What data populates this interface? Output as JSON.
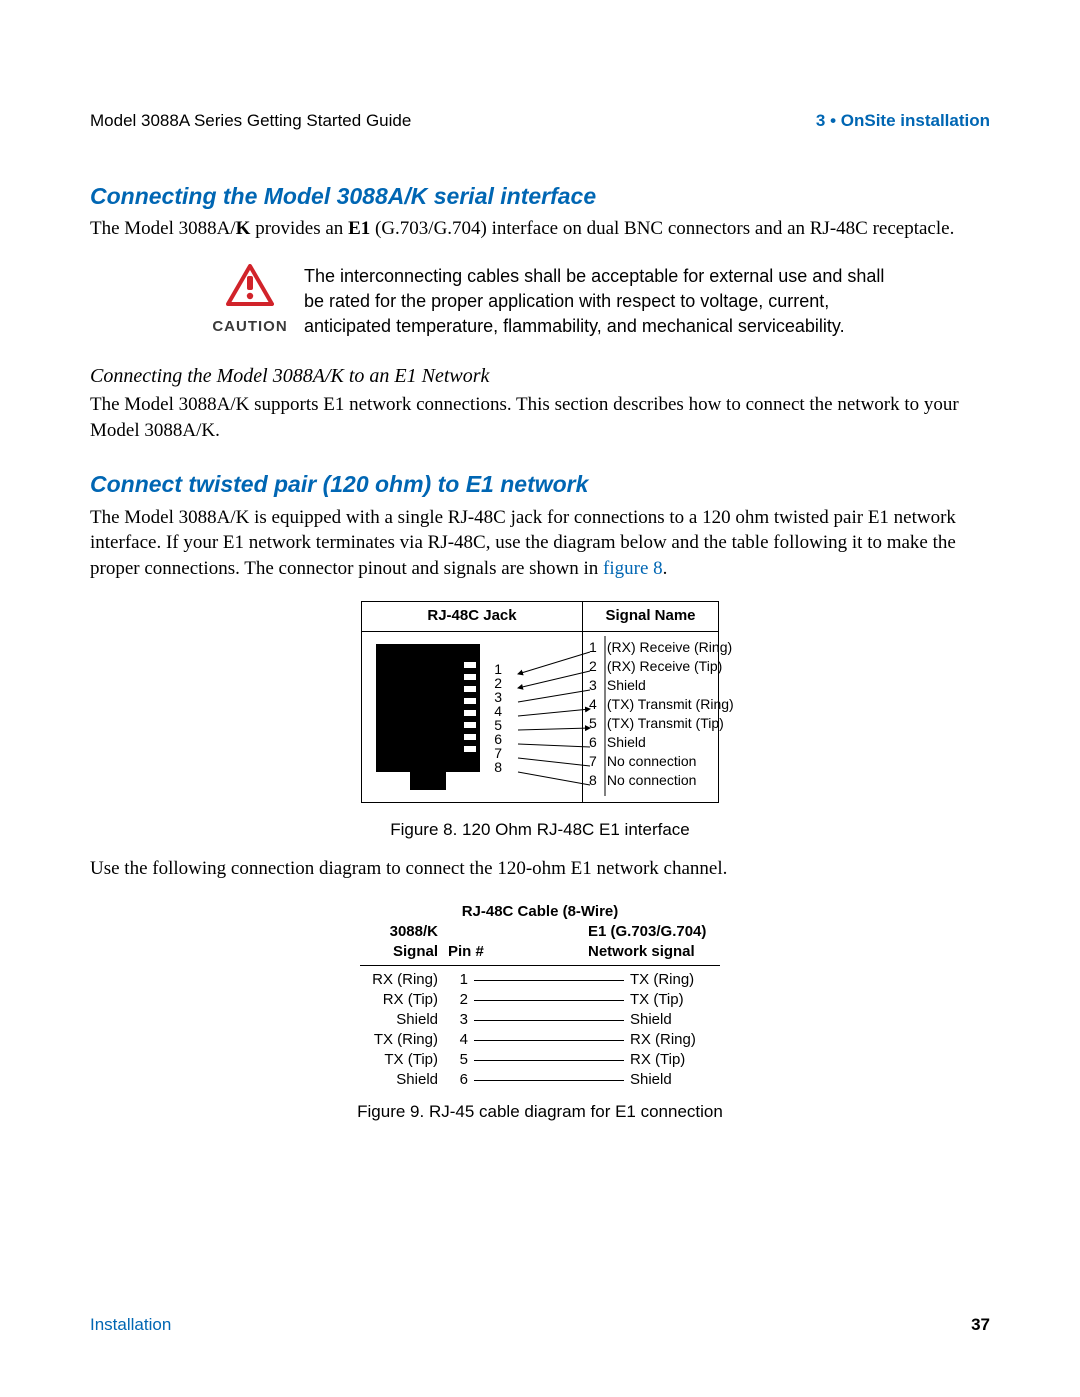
{
  "header": {
    "left": "Model 3088A Series Getting Started Guide",
    "right": "3 • OnSite installation"
  },
  "section1": {
    "heading": "Connecting the Model 3088A/K serial interface",
    "p1a": "The Model 3088A/",
    "p1b": "K",
    "p1c": " provides an ",
    "p1d": "E1",
    "p1e": " (G.703/G.704) interface on dual BNC connectors and an RJ-48C receptacle."
  },
  "caution": {
    "label": "CAUTION",
    "text": "The interconnecting cables shall be acceptable for external use and shall be rated for the proper application with respect to voltage, current, anticipated temperature, flammability, and mechanical serviceability."
  },
  "section2": {
    "subheading": "Connecting the Model 3088A/K to an E1 Network",
    "p": "The Model 3088A/K supports E1 network connections. This section describes how to connect the network to your Model 3088A/K."
  },
  "section3": {
    "heading": "Connect twisted pair (120 ohm) to E1 network",
    "p_pre": "The Model 3088A/K is equipped with a single RJ-48C jack for connections to a 120 ohm twisted pair E1 network interface. If your E1 network terminates via RJ-48C, use the diagram below and the table following it to make the proper connections. The connector pinout and signals are shown in ",
    "p_link": "figure 8",
    "p_post": "."
  },
  "fig8": {
    "col1": "RJ-48C Jack",
    "col2": "Signal Name",
    "jack_pins": [
      "1",
      "2",
      "3",
      "4",
      "5",
      "6",
      "7",
      "8"
    ],
    "signals": [
      {
        "pin": "1",
        "name": "(RX) Receive (Ring)"
      },
      {
        "pin": "2",
        "name": "(RX) Receive (Tip)"
      },
      {
        "pin": "3",
        "name": "Shield"
      },
      {
        "pin": "4",
        "name": "(TX) Transmit (Ring)"
      },
      {
        "pin": "5",
        "name": "(TX) Transmit (Tip)"
      },
      {
        "pin": "6",
        "name": "Shield"
      },
      {
        "pin": "7",
        "name": "No connection"
      },
      {
        "pin": "8",
        "name": "No connection"
      }
    ],
    "caption": "Figure 8. 120 Ohm RJ-48C E1 interface"
  },
  "after_fig8": "Use the following connection diagram to connect the 120-ohm E1 network channel.",
  "fig9": {
    "title": "RJ-48C Cable (8-Wire)",
    "left_head1": "3088/K",
    "left_head2": "Signal",
    "mid_head": "Pin #",
    "right_head1": "E1 (G.703/G.704)",
    "right_head2": "Network signal",
    "rows": [
      {
        "sig": "RX (Ring)",
        "pin": "1",
        "net": "TX (Ring)"
      },
      {
        "sig": "RX (Tip)",
        "pin": "2",
        "net": "TX (Tip)"
      },
      {
        "sig": "Shield",
        "pin": "3",
        "net": "Shield"
      },
      {
        "sig": "TX (Ring)",
        "pin": "4",
        "net": "RX (Ring)"
      },
      {
        "sig": "TX (Tip)",
        "pin": "5",
        "net": "RX (Tip)"
      },
      {
        "sig": "Shield",
        "pin": "6",
        "net": "Shield"
      }
    ],
    "caption": "Figure 9. RJ-45 cable diagram for E1 connection"
  },
  "footer": {
    "left": "Installation",
    "right": "37"
  },
  "colors": {
    "accent": "#0066b3",
    "caution": "#d1232a"
  }
}
